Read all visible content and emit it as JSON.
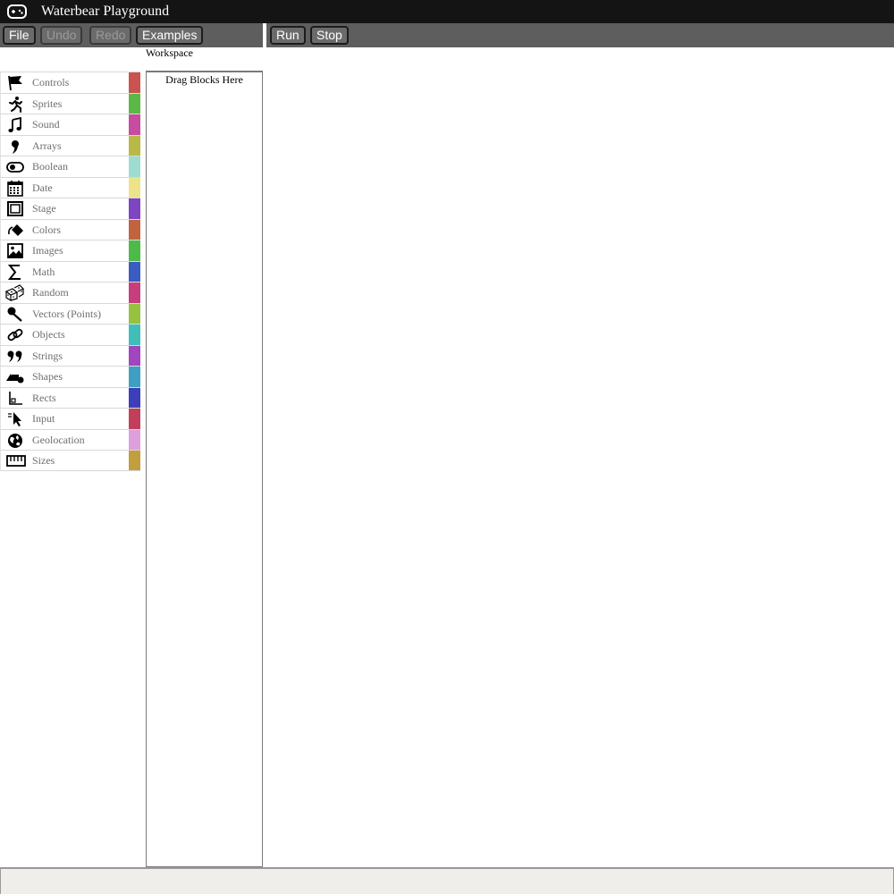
{
  "app": {
    "title": "Waterbear Playground",
    "logo_icon": "gamepad-icon"
  },
  "toolbar": {
    "file_label": "File",
    "undo_label": "Undo",
    "redo_label": "Redo",
    "examples_label": "Examples",
    "run_label": "Run",
    "stop_label": "Stop"
  },
  "workspace": {
    "label": "Workspace",
    "hint": "Drag Blocks Here"
  },
  "categories": [
    {
      "label": "Controls",
      "icon": "flag-icon",
      "color": "#c9534f"
    },
    {
      "label": "Sprites",
      "icon": "runner-icon",
      "color": "#5cb844"
    },
    {
      "label": "Sound",
      "icon": "music-note-icon",
      "color": "#c74b9f"
    },
    {
      "label": "Arrays",
      "icon": "comma-icon",
      "color": "#b9b945"
    },
    {
      "label": "Boolean",
      "icon": "toggle-icon",
      "color": "#9edcd0"
    },
    {
      "label": "Date",
      "icon": "calendar-icon",
      "color": "#ece38a"
    },
    {
      "label": "Stage",
      "icon": "stage-frame-icon",
      "color": "#7e45c2"
    },
    {
      "label": "Colors",
      "icon": "paint-bucket-icon",
      "color": "#c2633f"
    },
    {
      "label": "Images",
      "icon": "image-icon",
      "color": "#4cbb48"
    },
    {
      "label": "Math",
      "icon": "sigma-icon",
      "color": "#3b5cc1"
    },
    {
      "label": "Random",
      "icon": "dice-icon",
      "color": "#c63f7c"
    },
    {
      "label": "Vectors (Points)",
      "icon": "pin-icon",
      "color": "#97c23f"
    },
    {
      "label": "Objects",
      "icon": "link-icon",
      "color": "#3fbfb8"
    },
    {
      "label": "Strings",
      "icon": "quote-icon",
      "color": "#a145c0"
    },
    {
      "label": "Shapes",
      "icon": "shapes-icon",
      "color": "#3f9fc2"
    },
    {
      "label": "Rects",
      "icon": "rect-axis-icon",
      "color": "#3b3fb9"
    },
    {
      "label": "Input",
      "icon": "cursor-icon",
      "color": "#c23f5c"
    },
    {
      "label": "Geolocation",
      "icon": "globe-icon",
      "color": "#dea0dc"
    },
    {
      "label": "Sizes",
      "icon": "ruler-icon",
      "color": "#c29e3f"
    }
  ]
}
